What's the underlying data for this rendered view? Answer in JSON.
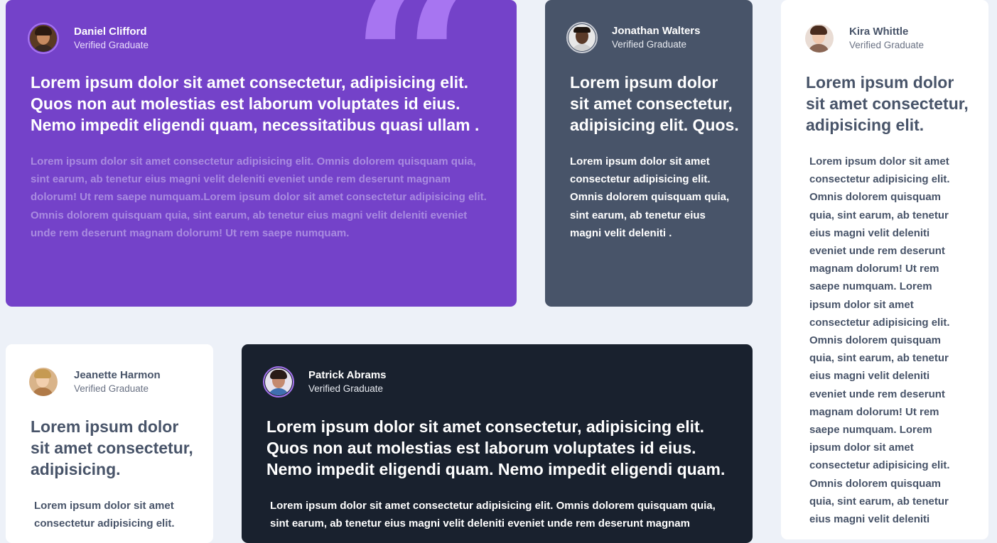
{
  "testimonials": [
    {
      "name": "Daniel Clifford",
      "role": "Verified Graduate",
      "headline": "Lorem ipsum dolor sit amet consectetur, adipisicing elit. Quos non aut molestias est laborum voluptates id eius. Nemo impedit eligendi quam, necessitatibus quasi ullam .",
      "body": "Lorem ipsum dolor sit amet consectetur adipisicing elit. Omnis dolorem quisquam quia, sint earum, ab tenetur eius magni velit deleniti eveniet unde rem deserunt magnam dolorum! Ut rem saepe numquam.Lorem ipsum dolor sit amet consectetur adipisicing elit. Omnis dolorem quisquam quia, sint earum, ab tenetur eius magni velit deleniti eveniet unde rem deserunt magnam dolorum! Ut rem saepe numquam."
    },
    {
      "name": "Jonathan Walters",
      "role": "Verified Graduate",
      "headline": "Lorem ipsum dolor sit amet consectetur, adipisicing elit. Quos.",
      "body": "Lorem ipsum dolor sit amet consectetur adipisicing elit. Omnis dolorem quisquam quia, sint earum, ab tenetur eius magni velit deleniti ."
    },
    {
      "name": "Kira Whittle",
      "role": "Verified Graduate",
      "headline": "Lorem ipsum dolor sit amet consectetur, adipisicing elit.",
      "body": "Lorem ipsum dolor sit amet consectetur adipisicing elit. Omnis dolorem quisquam quia, sint earum, ab tenetur eius magni velit deleniti eveniet unde rem deserunt magnam dolorum! Ut rem saepe numquam. Lorem ipsum dolor sit amet consectetur adipisicing elit. Omnis dolorem quisquam quia, sint earum, ab tenetur eius magni velit deleniti eveniet unde rem deserunt magnam dolorum! Ut rem saepe numquam. Lorem ipsum dolor sit amet consectetur adipisicing elit. Omnis dolorem quisquam quia, sint earum, ab tenetur eius magni velit deleniti"
    },
    {
      "name": "Jeanette Harmon",
      "role": "Verified Graduate",
      "headline": "Lorem ipsum dolor sit amet consectetur, adipisicing.",
      "body": "Lorem ipsum dolor sit amet consectetur adipisicing elit."
    },
    {
      "name": "Patrick Abrams",
      "role": "Verified Graduate",
      "headline": "Lorem ipsum dolor sit amet consectetur, adipisicing elit. Quos non aut molestias est laborum voluptates id eius. Nemo impedit eligendi quam. Nemo impedit eligendi quam.",
      "body": "Lorem ipsum dolor sit amet consectetur adipisicing elit. Omnis dolorem quisquam quia, sint earum, ab tenetur eius magni velit deleniti eveniet unde rem deserunt magnam"
    }
  ],
  "decor": {
    "quote_glyph": "“"
  },
  "colors": {
    "page_bg": "#edf1f8",
    "moderate_violet": "#7442c9",
    "grayish_blue": "#485469",
    "very_dark_blackish_blue": "#19212e",
    "white": "#ffffff",
    "light_violet_quote": "#a775f1"
  }
}
